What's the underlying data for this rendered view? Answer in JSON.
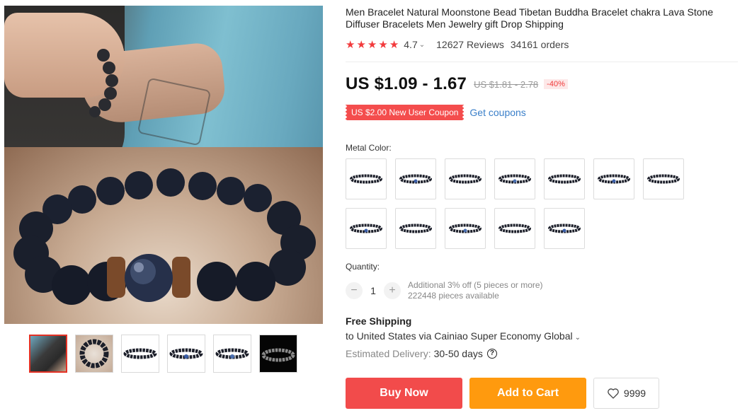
{
  "product": {
    "title": "Men Bracelet Natural Moonstone Bead Tibetan Buddha Bracelet chakra Lava Stone Diffuser Bracelets Men Jewelry gift Drop Shipping",
    "rating": {
      "stars": 5,
      "score": "4.7",
      "reviews": "12627 Reviews",
      "orders": "34161 orders"
    },
    "price": {
      "current": "US $1.09 - 1.67",
      "original": "US $1.81 - 2.78",
      "discount": "-40%"
    },
    "coupon": {
      "label": "US $2.00 New User Coupon",
      "link": "Get coupons"
    }
  },
  "variants": {
    "label": "Metal Color:",
    "options": [
      {
        "name": "option-1"
      },
      {
        "name": "option-2"
      },
      {
        "name": "option-3"
      },
      {
        "name": "option-4"
      },
      {
        "name": "option-5"
      },
      {
        "name": "option-6"
      },
      {
        "name": "option-7"
      },
      {
        "name": "option-8"
      },
      {
        "name": "option-9"
      },
      {
        "name": "option-10"
      },
      {
        "name": "option-11"
      },
      {
        "name": "option-12"
      }
    ]
  },
  "quantity": {
    "label": "Quantity:",
    "value": "1",
    "minus": "−",
    "plus": "+",
    "note_discount": "Additional 3% off (5 pieces or more)",
    "note_available": "222448 pieces available"
  },
  "shipping": {
    "title": "Free Shipping",
    "route": "to United States via Cainiao Super Economy Global",
    "delivery_label": "Estimated Delivery:",
    "delivery_value": "30-50 days",
    "help": "?"
  },
  "actions": {
    "buy_now": "Buy Now",
    "add_to_cart": "Add to Cart",
    "wishlist_count": "9999"
  },
  "colors": {
    "accent_red": "#f24b4b",
    "cart_orange": "#ff9a0e",
    "star_red": "#f23a3c",
    "link_blue": "#3a7fc9"
  }
}
